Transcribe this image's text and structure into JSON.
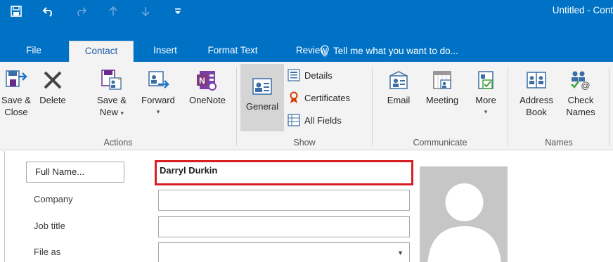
{
  "window": {
    "title": "Untitled - Cont"
  },
  "quick_access": {
    "save_icon": "save-icon",
    "undo_icon": "undo-icon",
    "redo_icon": "redo-icon",
    "up_icon": "up-arrow-icon",
    "down_icon": "down-arrow-icon",
    "customize_icon": "customize-qat-icon"
  },
  "tabs": [
    {
      "label": "File"
    },
    {
      "label": "Contact"
    },
    {
      "label": "Insert"
    },
    {
      "label": "Format Text"
    },
    {
      "label": "Review"
    }
  ],
  "tell_me": "Tell me what you want to do...",
  "ribbon": {
    "actions": {
      "label": "Actions",
      "save_close": [
        "Save &",
        "Close"
      ],
      "delete": "Delete",
      "save_new": [
        "Save &",
        "New"
      ],
      "forward": "Forward",
      "onenote": "OneNote"
    },
    "show": {
      "label": "Show",
      "general": "General",
      "details": "Details",
      "certificates": "Certificates",
      "all_fields": "All Fields"
    },
    "communicate": {
      "label": "Communicate",
      "email": "Email",
      "meeting": "Meeting",
      "more": "More"
    },
    "names": {
      "label": "Names",
      "address_book": [
        "Address",
        "Book"
      ],
      "check_names": [
        "Check",
        "Names"
      ]
    }
  },
  "form": {
    "full_name_button": "Full Name...",
    "full_name_value": "Darryl Durkin",
    "company_label": "Company",
    "company_value": "",
    "job_title_label": "Job title",
    "job_title_value": "",
    "file_as_label": "File as",
    "file_as_value": ""
  },
  "colors": {
    "accent": "#0072c6",
    "highlight_border": "#d81f26",
    "ribbon_bg": "#f3f3f3"
  }
}
